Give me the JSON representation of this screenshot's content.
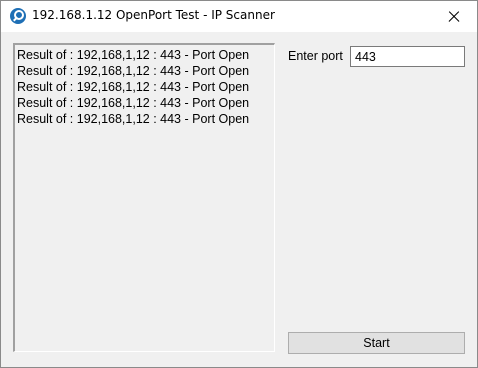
{
  "window": {
    "title": "192.168.1.12 OpenPort Test - IP Scanner",
    "icon": "scanner-app-icon",
    "close_icon": "close-icon"
  },
  "results": [
    "Result of : 192,168,1,12 : 443 - Port Open",
    "Result of : 192,168,1,12 : 443 - Port Open",
    "Result of : 192,168,1,12 : 443 - Port Open",
    "Result of : 192,168,1,12 : 443 - Port Open",
    "Result of : 192,168,1,12 : 443 - Port Open"
  ],
  "port": {
    "label": "Enter port",
    "value": "443"
  },
  "start_button": {
    "label": "Start"
  }
}
